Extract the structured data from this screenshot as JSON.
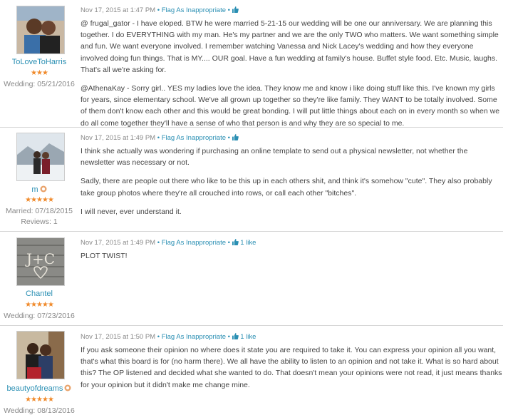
{
  "posts": [
    {
      "username": "ToLoveToHarris",
      "stars": "★★★",
      "meta_lines": [
        "Wedding: 05/21/2016"
      ],
      "timestamp": "Nov 17, 2015 at 1:47 PM",
      "flag_label": "Flag As Inappropriate",
      "like_count": "",
      "paragraphs": [
        "@ frugal_gator - I have eloped. BTW he were married 5-21-15 our wedding will be one our anniversary. We are planning this together. I do EVERYTHING with my man. He's my partner and we are the only TWO who matters. We want something simple and fun. We want everyone involved. I remember watching Vanessa and Nick Lacey's wedding and how they everyone involved doing fun things. That is MY.... OUR goal. Have a fun wedding at family's house. Buffet style food. Etc. Music, laughs. That's all we're asking for.",
        "@AthenaKay - Sorry girl.. YES my ladies love the idea. They know me and know i like doing stuff like this. I've known my girls for years, since elementary school. We've all grown up together so they're like family. They WANT to be totally involved. Some of them don't know each other and this would be great bonding. I will put little things about each on in every month so when we do all come together they'll have a sense of who that person is and why they are so special to me."
      ]
    },
    {
      "username": "m",
      "stars": "★★★★★",
      "meta_lines": [
        "Married: 07/18/2015",
        "Reviews: 1"
      ],
      "timestamp": "Nov 17, 2015 at 1:49 PM",
      "flag_label": "Flag As Inappropriate",
      "like_count": "",
      "paragraphs": [
        "I think she actually was wondering if purchasing an online template to send out a physical newsletter, not whether the newsletter was necessary or not.",
        "Sadly, there are people out there who like to be this up in each others shit, and think it's somehow \"cute\". They also probably take group photos where they're all crouched into rows, or call each other \"bitches\".",
        "I will never, ever understand it."
      ]
    },
    {
      "username": "Chantel",
      "stars": "★★★★★",
      "meta_lines": [
        "Wedding: 07/23/2016"
      ],
      "timestamp": "Nov 17, 2015 at 1:49 PM",
      "flag_label": "Flag As Inappropriate",
      "like_count": "1 like",
      "paragraphs": [
        "PLOT TWIST!"
      ]
    },
    {
      "username": "beautyofdreams",
      "stars": "★★★★★",
      "meta_lines": [
        "Wedding: 08/13/2016"
      ],
      "timestamp": "Nov 17, 2015 at 1:50 PM",
      "flag_label": "Flag As Inappropriate",
      "like_count": "1 like",
      "paragraphs": [
        "If you ask someone their opinion no where does it state you are required to take it. You can express your opinion all you want, that's what this board is for (no harm there). We all have the ability to listen to an opinion and not take it. What is so hard about this? The OP listened and decided what she wanted to do. That doesn't mean your opinions were not read, it just means thanks for your opinion but it didn't make me change mine."
      ]
    }
  ],
  "colors": {
    "link": "#2a8fb3",
    "star": "#f08a2b",
    "meta": "#888888",
    "divider": "#d6d6d6"
  },
  "separator": "•"
}
